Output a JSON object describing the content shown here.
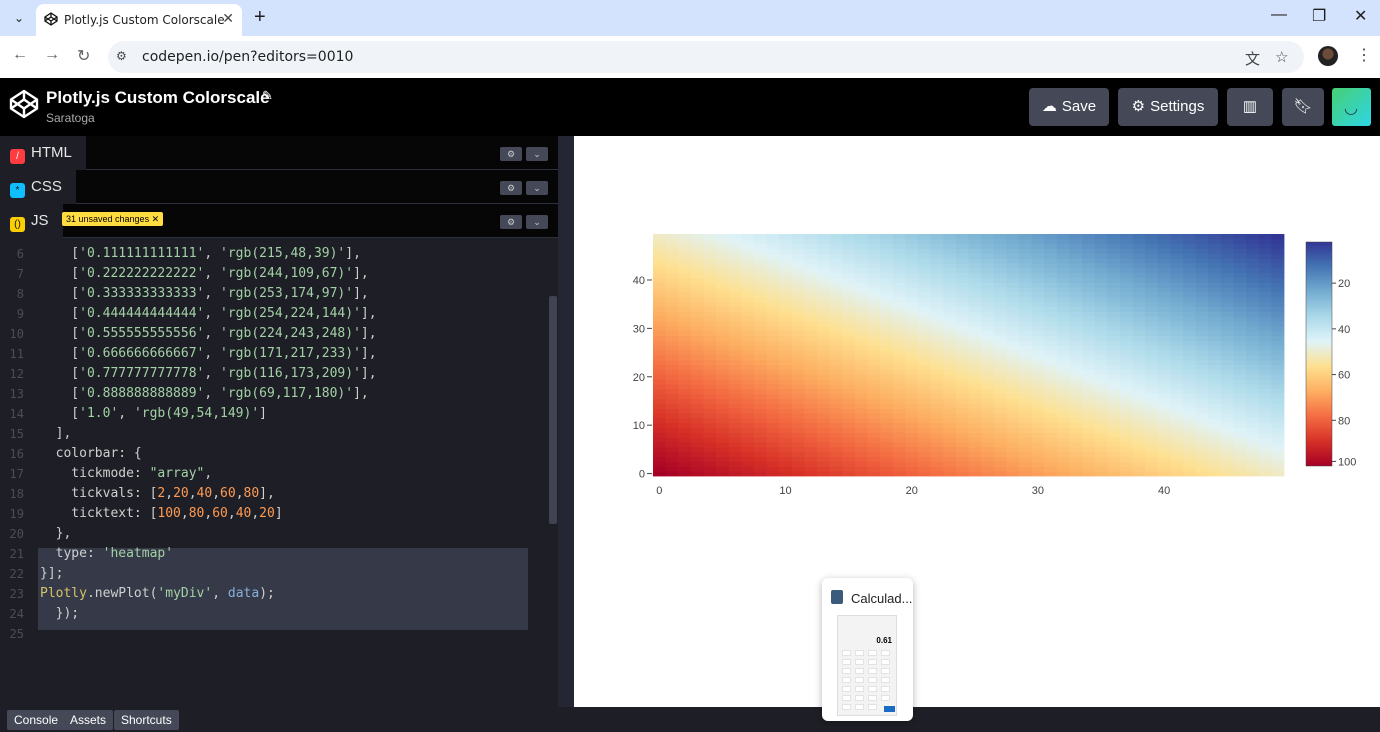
{
  "browser": {
    "tab_title": "Plotly.js Custom Colorscale",
    "url": "codepen.io/pen?editors=0010"
  },
  "codepen": {
    "title": "Plotly.js Custom Colorscale",
    "user": "Saratoga",
    "buttons": {
      "save": "Save",
      "settings": "Settings"
    }
  },
  "panes": {
    "html": "HTML",
    "css": "CSS",
    "js": "JS",
    "unsaved": "31 unsaved changes"
  },
  "code_lines": [
    {
      "n": "6",
      "t": "    ['0.111111111111', 'rgb(215,48,39)'],"
    },
    {
      "n": "7",
      "t": "    ['0.222222222222', 'rgb(244,109,67)'],"
    },
    {
      "n": "8",
      "t": "    ['0.333333333333', 'rgb(253,174,97)'],"
    },
    {
      "n": "9",
      "t": "    ['0.444444444444', 'rgb(254,224,144)'],"
    },
    {
      "n": "10",
      "t": "    ['0.555555555556', 'rgb(224,243,248)'],"
    },
    {
      "n": "11",
      "t": "    ['0.666666666667', 'rgb(171,217,233)'],"
    },
    {
      "n": "12",
      "t": "    ['0.777777777778', 'rgb(116,173,209)'],"
    },
    {
      "n": "13",
      "t": "    ['0.888888888889', 'rgb(69,117,180)'],"
    },
    {
      "n": "14",
      "t": "    ['1.0', 'rgb(49,54,149)']"
    },
    {
      "n": "15",
      "t": "  ],"
    },
    {
      "n": "16",
      "t": "  colorbar: {"
    },
    {
      "n": "17",
      "t": "    tickmode: \"array\","
    },
    {
      "n": "18",
      "t": "    tickvals: [2,20,40,60,80],"
    },
    {
      "n": "19",
      "t": "    ticktext: [100,80,60,40,20]"
    },
    {
      "n": "20",
      "t": "  },"
    },
    {
      "n": "21",
      "t": "  type: 'heatmap'"
    },
    {
      "n": "22",
      "t": "}];"
    },
    {
      "n": "23",
      "t": "Plotly.newPlot('myDiv', data);"
    },
    {
      "n": "24",
      "t": "  });"
    },
    {
      "n": "25",
      "t": ""
    }
  ],
  "footer": {
    "console": "Console",
    "assets": "Assets",
    "shortcuts": "Shortcuts"
  },
  "taskbar_thumb": {
    "title": "Calculad...",
    "display": "0.61"
  },
  "chart_data": {
    "type": "heatmap",
    "x_range": [
      0,
      49
    ],
    "y_range": [
      0,
      49
    ],
    "x_ticks": [
      0,
      10,
      20,
      30,
      40
    ],
    "y_ticks": [
      0,
      10,
      20,
      30,
      40
    ],
    "z_formula": "x + y",
    "zlim": [
      0,
      98
    ],
    "colorscale": [
      [
        0.0,
        "rgb(165,0,38)"
      ],
      [
        0.111111111111,
        "rgb(215,48,39)"
      ],
      [
        0.222222222222,
        "rgb(244,109,67)"
      ],
      [
        0.333333333333,
        "rgb(253,174,97)"
      ],
      [
        0.444444444444,
        "rgb(254,224,144)"
      ],
      [
        0.555555555556,
        "rgb(224,243,248)"
      ],
      [
        0.666666666667,
        "rgb(171,217,233)"
      ],
      [
        0.777777777778,
        "rgb(116,173,209)"
      ],
      [
        0.888888888889,
        "rgb(69,117,180)"
      ],
      [
        1.0,
        "rgb(49,54,149)"
      ]
    ],
    "colorbar": {
      "tickvals": [
        2,
        20,
        40,
        60,
        80
      ],
      "ticktext": [
        "100",
        "80",
        "60",
        "40",
        "20"
      ]
    }
  }
}
